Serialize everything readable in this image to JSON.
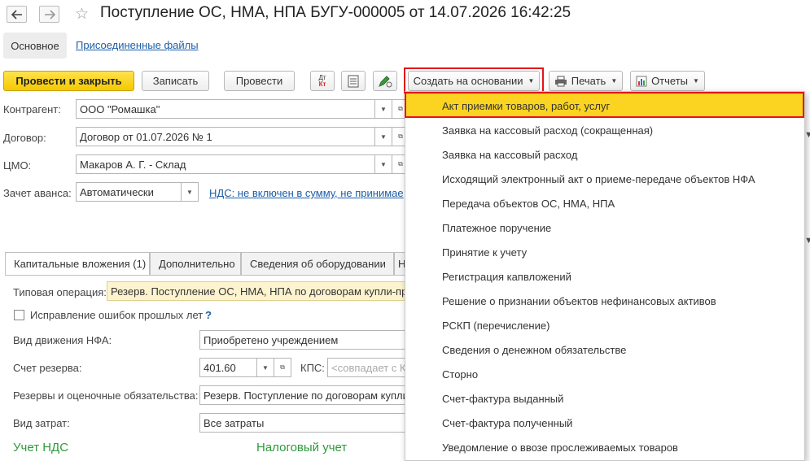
{
  "window": {
    "title": "Поступление ОС, НМА, НПА БУГУ-000005 от 14.07.2026 16:42:25"
  },
  "nav": {
    "back_icon": "arrow-left-icon",
    "forward_icon": "arrow-right-icon",
    "favorite_icon": "star-icon"
  },
  "tabs": {
    "main": "Основное",
    "attached": "Присоединенные файлы"
  },
  "toolbar": {
    "post_close": "Провести и закрыть",
    "save": "Записать",
    "post": "Провести",
    "dt_kt_top": "Дт",
    "dt_kt_bottom": "Кт",
    "create_based": "Создать на основании",
    "print": "Печать",
    "reports": "Отчеты"
  },
  "form": {
    "counterparty_label": "Контрагент:",
    "counterparty_value": "ООО \"Ромашка\"",
    "contract_label": "Договор:",
    "contract_value": "Договор от 01.07.2026 № 1",
    "cmo_label": "ЦМО:",
    "cmo_value": "Макаров А. Г. - Склад",
    "advance_label": "Зачет аванса:",
    "advance_value": "Автоматически",
    "vat_link": "НДС: не включен в сумму, не принимае"
  },
  "lower_tabs": [
    "Капитальные вложения (1)",
    "Дополнительно",
    "Сведения об оборудовании",
    "Н"
  ],
  "details": {
    "op_label": "Типовая операция:",
    "op_value": "Резерв. Поступление ОС, НМА, НПА по договорам купли-пр",
    "fix_label": "Исправление ошибок прошлых лет",
    "help": "?",
    "movement_label": "Вид движения НФА:",
    "movement_value": "Приобретено учреждением",
    "reserve_acc_label": "Счет резерва:",
    "reserve_acc_value": "401.60",
    "kps_label": "КПС:",
    "kps_placeholder": "<совпадает с К",
    "reserves_label": "Резервы и оценочные обязательства:",
    "reserves_value": "Резерв. Поступление по договорам купли",
    "cost_label": "Вид затрат:",
    "cost_value": "Все затраты",
    "vat_section": "Учет НДС",
    "tax_section": "Налоговый учет"
  },
  "menu": {
    "items": [
      "Акт приемки товаров, работ, услуг",
      "Заявка на кассовый расход (сокращенная)",
      "Заявка на кассовый расход",
      "Исходящий электронный акт о приеме-передаче объектов НФА",
      "Передача объектов ОС, НМА, НПА",
      "Платежное поручение",
      "Принятие к учету",
      "Регистрация капвложений",
      "Решение о признании объектов нефинансовых активов",
      "РСКП (перечисление)",
      "Сведения о денежном обязательстве",
      "Сторно",
      "Счет-фактура выданный",
      "Счет-фактура полученный",
      "Уведомление о ввозе прослеживаемых товаров"
    ]
  },
  "colors": {
    "accent": "#fbd421",
    "link": "#1c5ea8",
    "highlight_frame": "#e3141b",
    "section": "#2e9a3a"
  }
}
